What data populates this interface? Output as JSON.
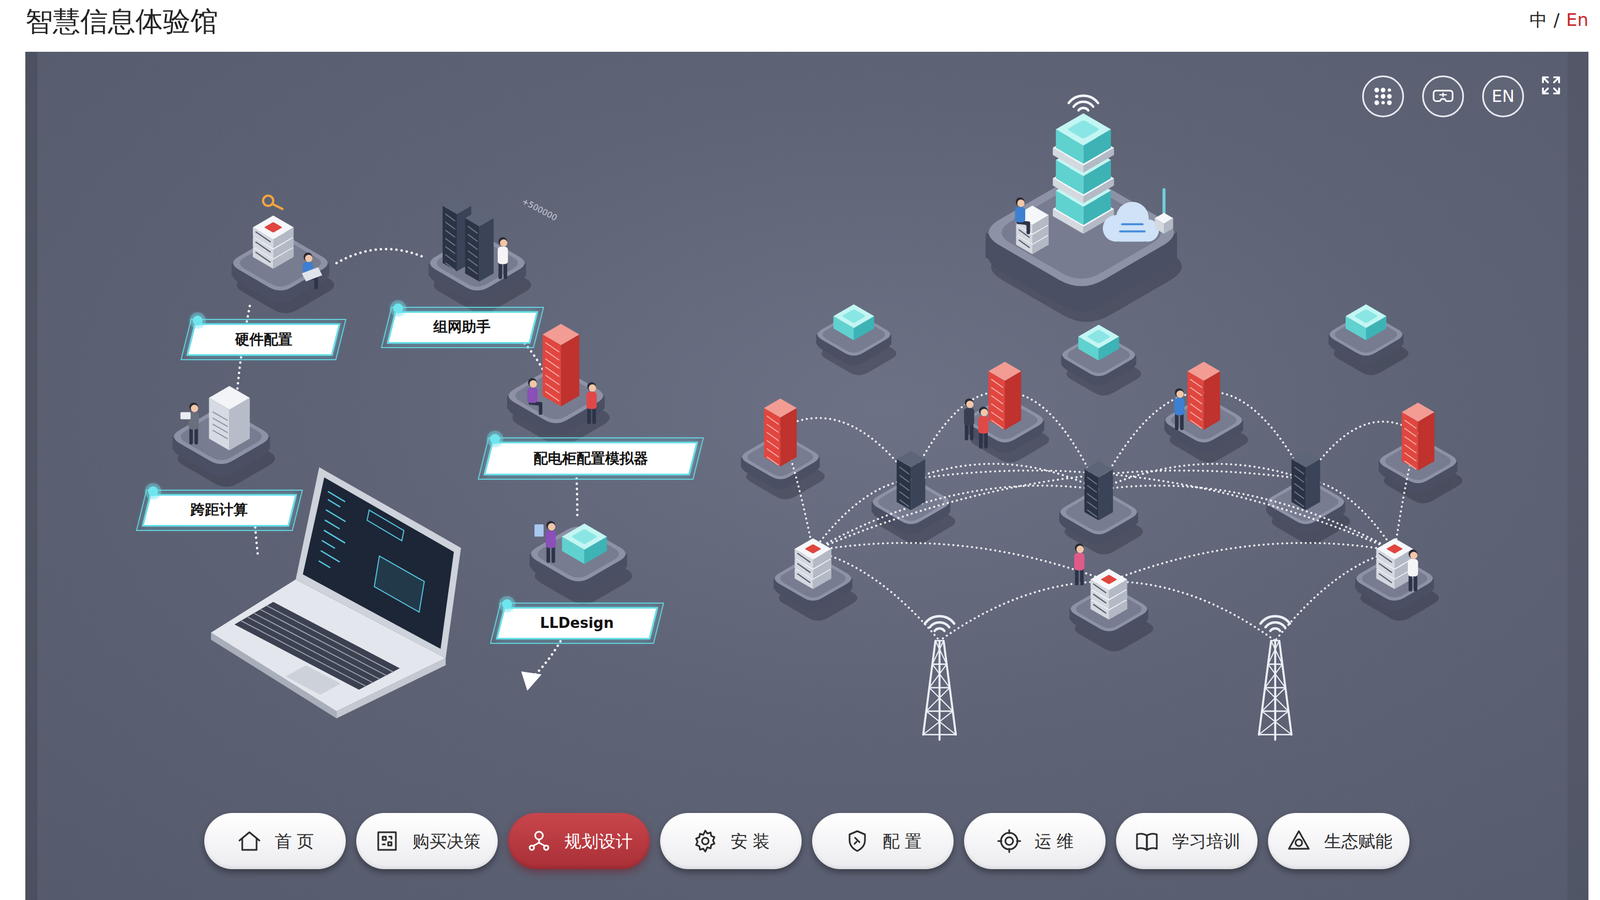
{
  "header": {
    "title": "智慧信息体验馆",
    "language_switch": [
      {
        "label": "中",
        "selected": false
      },
      {
        "label": "En",
        "selected": true
      }
    ],
    "separator": "/"
  },
  "toolbar": {
    "language_button": "EN"
  },
  "diagram": {
    "tools": [
      {
        "label": "硬件配置"
      },
      {
        "label": "组网助手"
      },
      {
        "label": "配电柜配置模拟器"
      },
      {
        "label": "跨距计算"
      },
      {
        "label": "LLDesign"
      }
    ],
    "badge": "+500000"
  },
  "nav": [
    {
      "label": "首 页",
      "selected": false
    },
    {
      "label": "购买决策",
      "selected": false
    },
    {
      "label": "规划设计",
      "selected": true
    },
    {
      "label": "安 装",
      "selected": false
    },
    {
      "label": "配 置",
      "selected": false
    },
    {
      "label": "运 维",
      "selected": false
    },
    {
      "label": "学习培训",
      "selected": false
    },
    {
      "label": "生态赋能",
      "selected": false
    }
  ]
}
